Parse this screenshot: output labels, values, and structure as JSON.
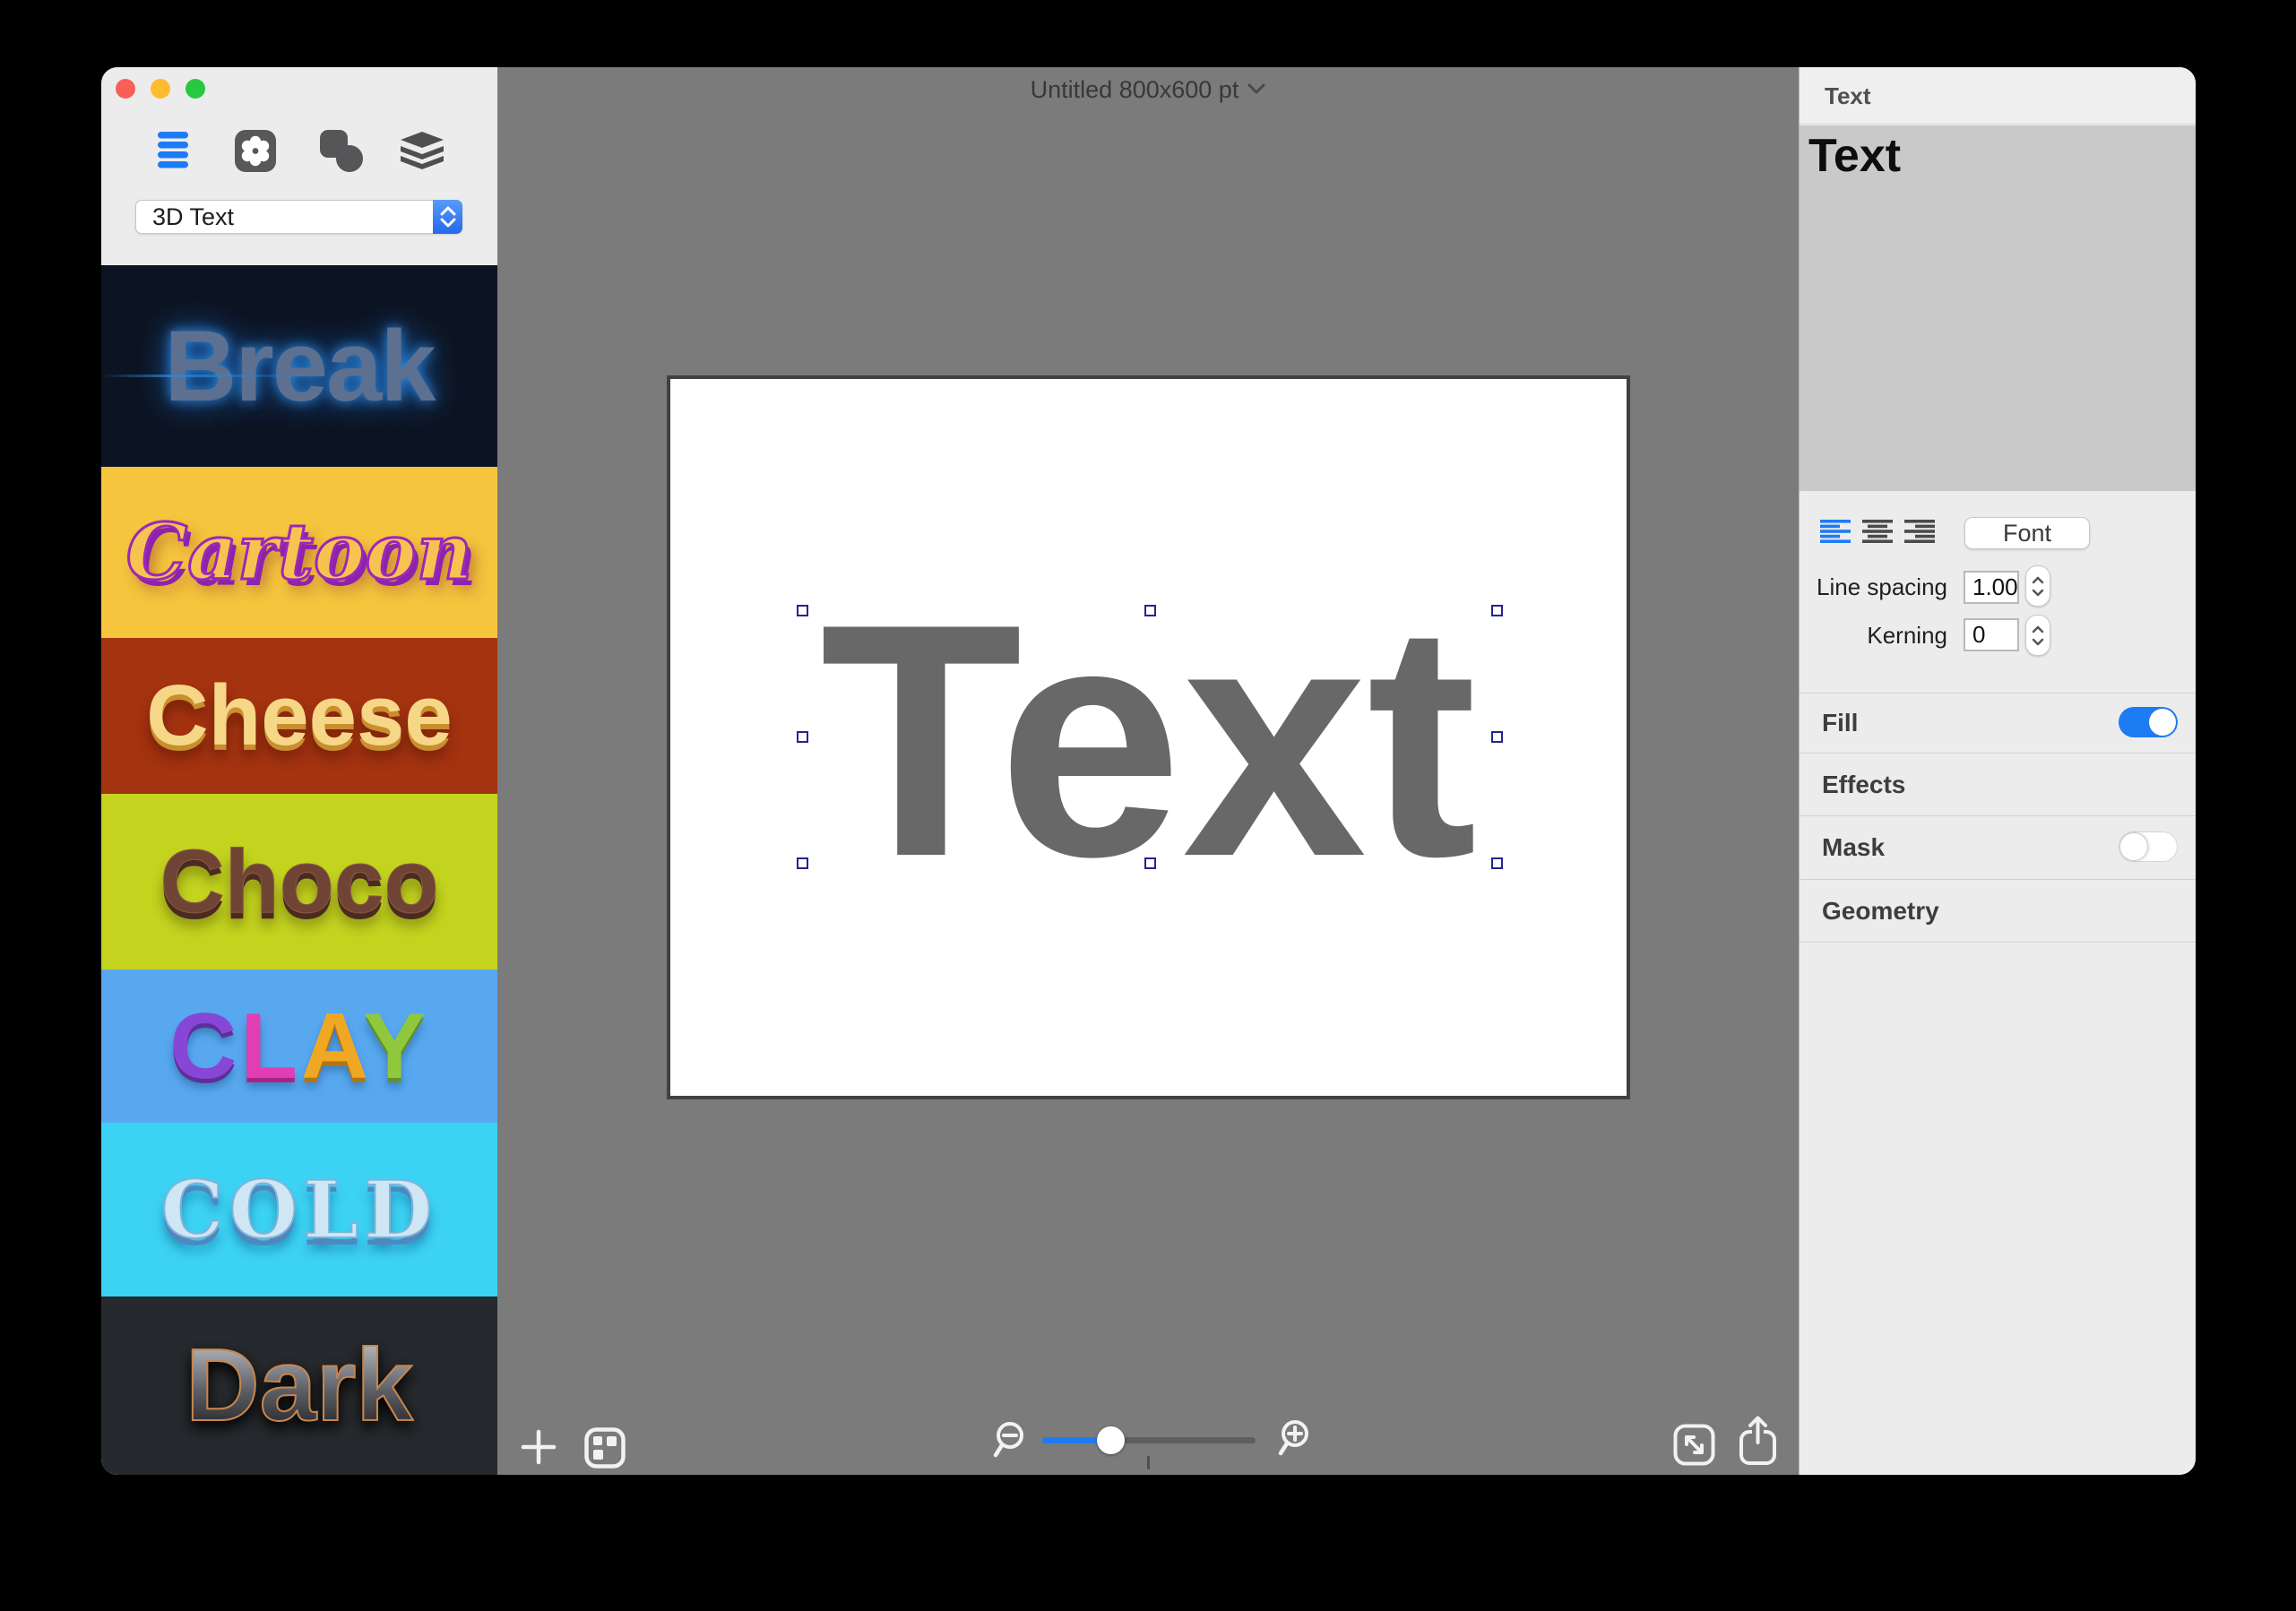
{
  "app": {
    "accent_color": "#1d7bf4"
  },
  "titlebar": {
    "document_title": "Untitled 800x600 pt"
  },
  "sidebar": {
    "tabs": [
      {
        "icon": "list-icon",
        "selected": true
      },
      {
        "icon": "styles-flower-icon",
        "selected": false
      },
      {
        "icon": "shapes-icon",
        "selected": false
      },
      {
        "icon": "layers-icon",
        "selected": false
      }
    ],
    "category_dropdown": {
      "value": "3D Text"
    },
    "templates": [
      {
        "label": "Break",
        "bg": "#0d1421",
        "fg": "#5d7090"
      },
      {
        "label": "Cartoon",
        "bg": "#f5c53d",
        "fg": "#f7c350",
        "outline": "#9c27b8"
      },
      {
        "label": "Cheese",
        "bg": "#a43310",
        "fg": "#f6d788"
      },
      {
        "label": "Choco",
        "bg": "#c3d31e",
        "fg": "#6f4434"
      },
      {
        "label": "CLAY",
        "bg": "#58a8f0",
        "letters": [
          {
            "char": "C",
            "color": "#8747d6"
          },
          {
            "char": "L",
            "color": "#e23eb4"
          },
          {
            "char": "A",
            "color": "#f0a824"
          },
          {
            "char": "Y",
            "color": "#90c83d"
          }
        ]
      },
      {
        "label": "COLD",
        "bg": "#3cd2f4",
        "fg": "#cfe6f4"
      },
      {
        "label": "Dark",
        "bg": "#26292d",
        "fg": "#9aa0a8",
        "outline": "#c8854a"
      }
    ]
  },
  "canvas": {
    "text": "Text",
    "text_color": "#686868",
    "background": "#ffffff",
    "workspace_color": "#7b7b7b"
  },
  "statusbar": {
    "icons": [
      "add-icon",
      "collage-grid-icon",
      "zoom-out-icon",
      "zoom-in-icon",
      "resize-icon",
      "share-icon"
    ]
  },
  "panel": {
    "header": "Text",
    "editor_text": "Text",
    "font_button": "Font",
    "alignment": {
      "options": [
        "left",
        "center",
        "right"
      ],
      "selected": "left"
    },
    "line_spacing": {
      "label": "Line spacing",
      "value": "1.00"
    },
    "kerning": {
      "label": "Kerning",
      "value": "0"
    },
    "sections": [
      {
        "label": "Fill",
        "has_toggle": true,
        "state": "on"
      },
      {
        "label": "Effects",
        "has_toggle": false,
        "state": ""
      },
      {
        "label": "Mask",
        "has_toggle": true,
        "state": "off"
      },
      {
        "label": "Geometry",
        "has_toggle": false,
        "state": ""
      }
    ]
  }
}
